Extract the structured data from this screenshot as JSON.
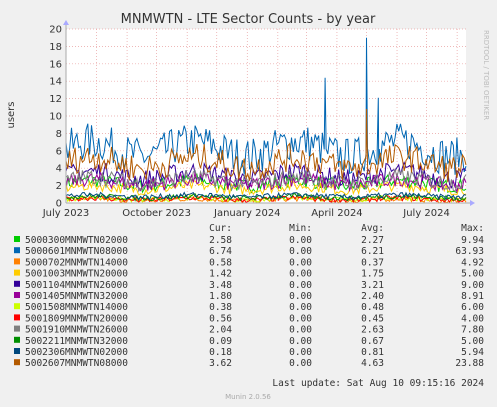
{
  "chart_data": {
    "type": "line",
    "title": "MNMWTN - LTE Sector Counts - by year",
    "ylabel": "users",
    "xlabel": "",
    "ylim": [
      0,
      20
    ],
    "y_ticks": [
      "0",
      "2",
      "4",
      "6",
      "8",
      "10",
      "12",
      "14",
      "16",
      "18",
      "20"
    ],
    "x_ticks": [
      "July 2023",
      "October 2023",
      "January 2024",
      "April 2024",
      "July 2024"
    ],
    "x_range": [
      "2023-07-01",
      "2024-08-10"
    ],
    "grid": true,
    "legend_placement": "bottom",
    "legend_headers": [
      "Cur:",
      "Min:",
      "Avg:",
      "Max:"
    ],
    "series": [
      {
        "name": "5000300MNMWTN02000",
        "color": "#00cc00",
        "cur": "2.58",
        "min": "0.00",
        "avg": "2.27",
        "max": "9.94"
      },
      {
        "name": "5000601MNMWTN08000",
        "color": "#0066b3",
        "cur": "6.74",
        "min": "0.00",
        "avg": "6.21",
        "max": "63.93"
      },
      {
        "name": "5000702MNMWTN14000",
        "color": "#ff8000",
        "cur": "0.58",
        "min": "0.00",
        "avg": "0.37",
        "max": "4.92"
      },
      {
        "name": "5001003MNMWTN20000",
        "color": "#ffcc00",
        "cur": "1.42",
        "min": "0.00",
        "avg": "1.75",
        "max": "5.00"
      },
      {
        "name": "5001104MNMWTN26000",
        "color": "#330099",
        "cur": "3.48",
        "min": "0.00",
        "avg": "3.21",
        "max": "9.00"
      },
      {
        "name": "5001405MNMWTN32000",
        "color": "#990099",
        "cur": "1.80",
        "min": "0.00",
        "avg": "2.40",
        "max": "8.91"
      },
      {
        "name": "5001508MNMWTN14000",
        "color": "#ccff00",
        "cur": "0.38",
        "min": "0.00",
        "avg": "0.48",
        "max": "6.00"
      },
      {
        "name": "5001809MNMWTN20000",
        "color": "#ff0000",
        "cur": "0.56",
        "min": "0.00",
        "avg": "0.45",
        "max": "4.00"
      },
      {
        "name": "5001910MNMWTN26000",
        "color": "#808080",
        "cur": "2.04",
        "min": "0.00",
        "avg": "2.63",
        "max": "7.80"
      },
      {
        "name": "5002211MNMWTN32000",
        "color": "#008f00",
        "cur": "0.09",
        "min": "0.00",
        "avg": "0.67",
        "max": "5.00"
      },
      {
        "name": "5002306MNMWTN02000",
        "color": "#00487d",
        "cur": "0.18",
        "min": "0.00",
        "avg": "0.81",
        "max": "5.94"
      },
      {
        "name": "5002607MNMWTN08000",
        "color": "#b35a00",
        "cur": "3.62",
        "min": "0.00",
        "avg": "4.63",
        "max": "23.88"
      }
    ]
  },
  "side_label": "RRDTOOL / TOBI OETIKER",
  "last_update": "Last update: Sat Aug 10 09:15:16 2024",
  "footer": "Munin 2.0.56"
}
